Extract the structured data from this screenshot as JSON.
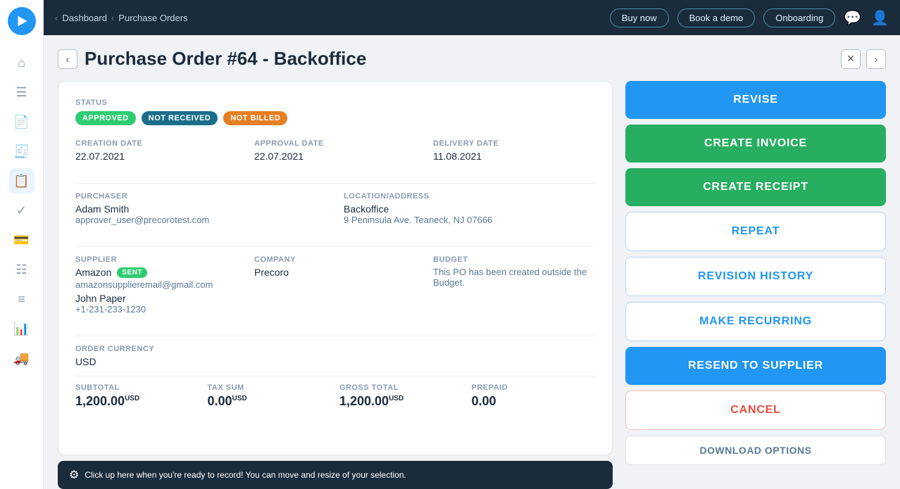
{
  "app": {
    "logo_unicode": "▶"
  },
  "topbar": {
    "breadcrumb": [
      "Dashboard",
      "Purchase Orders"
    ],
    "buttons": [
      "Buy now",
      "Book a demo",
      "Onboarding"
    ]
  },
  "sidebar": {
    "icons": [
      {
        "name": "home-icon",
        "unicode": "⌂",
        "active": false
      },
      {
        "name": "list-icon",
        "unicode": "☰",
        "active": false
      },
      {
        "name": "document-icon",
        "unicode": "📄",
        "active": false
      },
      {
        "name": "receipt-icon",
        "unicode": "🧾",
        "active": false
      },
      {
        "name": "orders-icon",
        "unicode": "📋",
        "active": true
      },
      {
        "name": "check-icon",
        "unicode": "✓",
        "active": false
      },
      {
        "name": "wallet-icon",
        "unicode": "💳",
        "active": false
      },
      {
        "name": "bank-icon",
        "unicode": "🏦",
        "active": false
      },
      {
        "name": "menu-icon",
        "unicode": "≡",
        "active": false
      },
      {
        "name": "chart-icon",
        "unicode": "📊",
        "active": false
      },
      {
        "name": "truck-icon",
        "unicode": "🚚",
        "active": false
      },
      {
        "name": "settings-icon",
        "unicode": "⚙",
        "active": false
      }
    ]
  },
  "page": {
    "title": "Purchase Order #64 - Backoffice"
  },
  "po": {
    "status_label": "STATUS",
    "statuses": [
      {
        "label": "APPROVED",
        "type": "approved"
      },
      {
        "label": "NOT RECEIVED",
        "type": "not-received"
      },
      {
        "label": "NOT BILLED",
        "type": "not-billed"
      }
    ],
    "creation_date_label": "CREATION DATE",
    "creation_date": "22.07.2021",
    "approval_date_label": "APPROVAL DATE",
    "approval_date": "22.07.2021",
    "delivery_date_label": "DELIVERY DATE",
    "delivery_date": "11.08.2021",
    "purchaser_label": "PURCHASER",
    "purchaser_name": "Adam Smith",
    "purchaser_email": "approver_user@precorotest.com",
    "location_label": "LOCATION/ADDRESS",
    "location_name": "Backoffice",
    "location_address": "9 Peninsula Ave. Teaneck, NJ 07666",
    "supplier_label": "SUPPLIER",
    "supplier_name": "Amazon",
    "supplier_badge": "SENT",
    "supplier_email": "amazonsupplieremail@gmail.com",
    "supplier_contact": "John Paper",
    "supplier_phone": "+1-231-233-1230",
    "company_label": "COMPANY",
    "company_name": "Precoro",
    "budget_label": "BUDGET",
    "budget_text": "This PO has been created outside the Budget.",
    "currency_label": "ORDER CURRENCY",
    "currency": "USD",
    "subtotal_label": "SUBTOTAL",
    "subtotal_value": "1,200.00",
    "subtotal_currency": "USD",
    "tax_sum_label": "TAX SUM",
    "tax_sum_value": "0.00",
    "tax_sum_currency": "USD",
    "gross_total_label": "GROSS TOTAL",
    "gross_total_value": "1,200.00",
    "gross_total_currency": "USD",
    "prepaid_label": "PREPAID",
    "prepaid_value": "0.00"
  },
  "tooltip": {
    "icon": "⚙",
    "text": "Click up here when you're ready to record! You can move and resize of your selection."
  },
  "actions": {
    "revise": "REVISE",
    "create_invoice": "CREATE INVOICE",
    "create_receipt": "CREATE RECEIPT",
    "repeat": "REPEAT",
    "revision_history": "REVISION HISTORY",
    "make_recurring": "MAKE RECURRING",
    "resend_to_supplier": "RESEND TO SUPPLIER",
    "cancel": "CANCEL",
    "download_options": "DOWNLOAD OPTIONS"
  }
}
